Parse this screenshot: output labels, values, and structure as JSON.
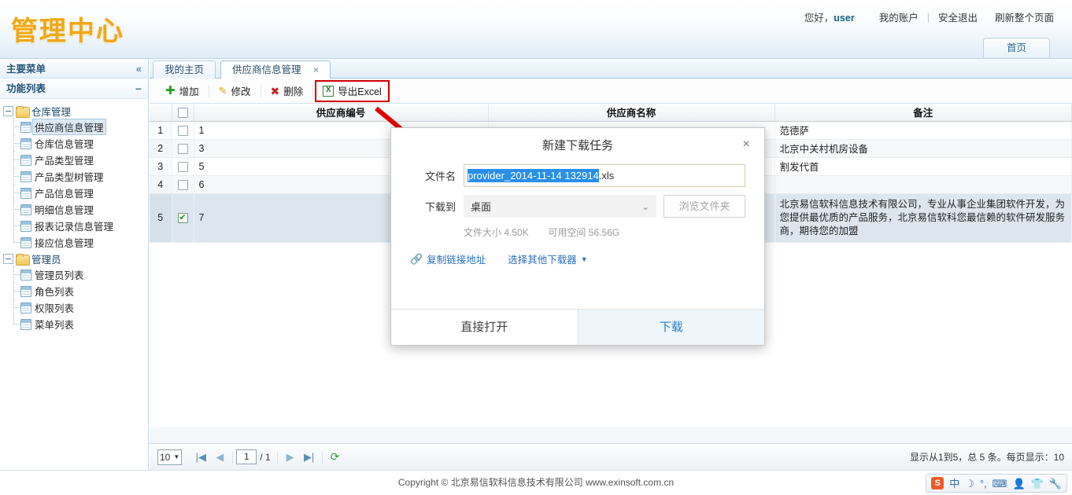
{
  "header": {
    "brand": "管理中心",
    "greeting_prefix": "您好，",
    "user": "user",
    "nav": [
      {
        "label": "我的账户"
      },
      {
        "label": "安全退出"
      },
      {
        "label": "刷新整个页面"
      }
    ],
    "home_button": "首页"
  },
  "sidebar": {
    "main_menu_title": "主要菜单",
    "collapse_icon": "«",
    "function_list_title": "功能列表",
    "minimize_icon": "−",
    "groups": [
      {
        "label": "仓库管理",
        "items": [
          {
            "label": "供应商信息管理",
            "selected": true
          },
          {
            "label": "仓库信息管理"
          },
          {
            "label": "产品类型管理"
          },
          {
            "label": "产品类型树管理"
          },
          {
            "label": "产品信息管理"
          },
          {
            "label": "明细信息管理"
          },
          {
            "label": "报表记录信息管理"
          },
          {
            "label": "接应信息管理"
          }
        ]
      },
      {
        "label": "管理员",
        "items": [
          {
            "label": "管理员列表"
          },
          {
            "label": "角色列表"
          },
          {
            "label": "权限列表"
          },
          {
            "label": "菜单列表"
          }
        ]
      }
    ]
  },
  "tabs": [
    {
      "label": "我的主页",
      "active": false,
      "closable": false
    },
    {
      "label": "供应商信息管理",
      "active": true,
      "closable": true,
      "close_icon": "×"
    }
  ],
  "toolbar": {
    "add_label": "增加",
    "edit_label": "修改",
    "delete_label": "删除",
    "export_label": "导出Excel",
    "export_icon_text": "X",
    "highlight_color": "#d00000"
  },
  "grid": {
    "columns": [
      "供应商编号",
      "供应商名称",
      "备注"
    ],
    "rows": [
      {
        "n": "1",
        "checked": false,
        "code": "1",
        "name": "",
        "notes": "范德萨"
      },
      {
        "n": "2",
        "checked": false,
        "code": "3",
        "name": "",
        "notes": "北京中关村机房设备"
      },
      {
        "n": "3",
        "checked": false,
        "code": "5",
        "name": "",
        "notes": "割发代首"
      },
      {
        "n": "4",
        "checked": false,
        "code": "6",
        "name": "",
        "notes": ""
      },
      {
        "n": "5",
        "checked": true,
        "code": "7",
        "name": "",
        "notes": "北京易信软科信息技术有限公司，专业从事企业集团软件开发，为您提供最优质的产品服务，北京易信软科您最信赖的软件研发服务商，期待您的加盟"
      }
    ]
  },
  "dialog": {
    "title": "新建下载任务",
    "close_icon": "×",
    "filename_label": "文件名",
    "filename_selected": "provider_2014-11-14 132914",
    "filename_ext": ".xls",
    "saveto_label": "下载到",
    "saveto_value": "桌面",
    "dropdown_icon": "⌄",
    "browse_label": "浏览文件夹",
    "filesize_label": "文件大小",
    "filesize_value": "4.50K",
    "freespace_label": "可用空间",
    "freespace_value": "56.56G",
    "copy_link_label": "复制链接地址",
    "link_icon": "🔗",
    "other_downloader_label": "选择其他下载器",
    "caret_icon": "▼",
    "open_label": "直接打开",
    "download_label": "下载",
    "accent_color": "#2a7fc9"
  },
  "pager": {
    "page_size": "10",
    "page_size_caret": "▼",
    "first_icon": "|◀",
    "prev_icon": "◀",
    "current_page": "1",
    "total_pages": "/ 1",
    "next_icon": "▶",
    "last_icon": "▶|",
    "refresh_icon": "⟳",
    "info": "显示从1到5，总 5 条。每页显示：10"
  },
  "footer": {
    "copyright": "Copyright © 北京易信软科信息技术有限公司 www.exinsoft.com.cn"
  },
  "ime": {
    "logo": "S",
    "items": [
      "中",
      "☽",
      "°,",
      "⌨",
      "👤",
      "👕",
      "🔧"
    ]
  }
}
